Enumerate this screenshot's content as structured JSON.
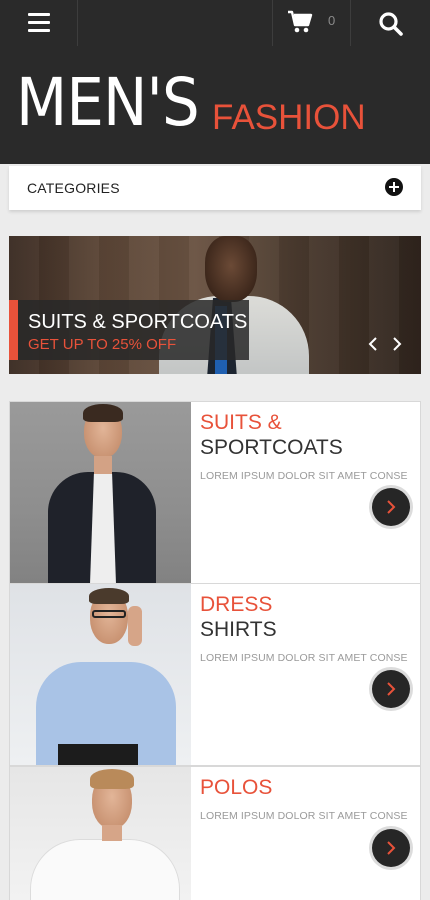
{
  "header": {
    "menu_icon": "hamburger-menu-icon",
    "cart_icon": "cart-icon",
    "cart_count": "0",
    "search_icon": "search-icon"
  },
  "hero": {
    "title_main": "MEN'S",
    "title_sub": "FASHION"
  },
  "categories": {
    "label": "CATEGORIES",
    "expand_icon": "plus-circle-icon"
  },
  "banner": {
    "title": "SUITS & SPORTCOATS",
    "subtitle": "GET UP TO 25% OFF",
    "prev_icon": "chevron-left-icon",
    "next_icon": "chevron-right-icon"
  },
  "products": [
    {
      "title_accent": "SUITS &",
      "title_rest": "SPORTCOATS",
      "description": "LOREM IPSUM DOLOR SIT AMET CONSE"
    },
    {
      "title_accent": "DRESS",
      "title_rest": "SHIRTS",
      "description": "LOREM IPSUM DOLOR SIT AMET CONSE"
    },
    {
      "title_accent": "POLOS",
      "title_rest": "",
      "description": "LOREM IPSUM DOLOR SIT AMET CONSE"
    }
  ],
  "colors": {
    "accent": "#e8523a",
    "dark": "#2a2a2a"
  }
}
